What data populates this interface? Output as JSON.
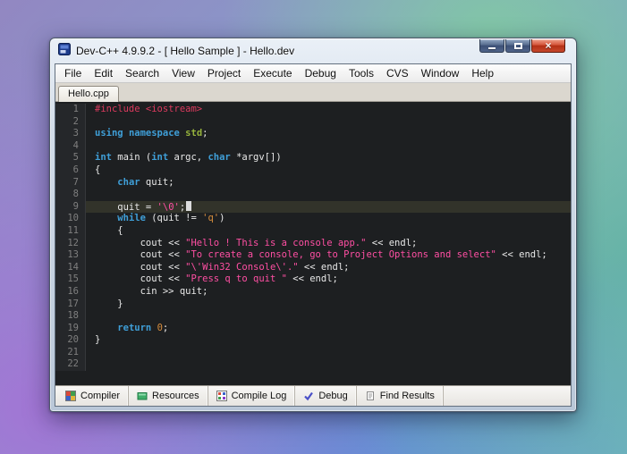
{
  "window": {
    "title": "Dev-C++ 4.9.9.2 -  [ Hello Sample ] - Hello.dev",
    "controls": {
      "close_glyph": "×"
    }
  },
  "menubar": {
    "items": [
      "File",
      "Edit",
      "Search",
      "View",
      "Project",
      "Execute",
      "Debug",
      "Tools",
      "CVS",
      "Window",
      "Help"
    ]
  },
  "editor_tab": {
    "label": "Hello.cpp"
  },
  "editor": {
    "language": "cpp",
    "current_line": 9,
    "lines": [
      {
        "segs": [
          [
            "pp",
            "#include <iostream>"
          ]
        ]
      },
      {
        "segs": []
      },
      {
        "segs": [
          [
            "kw",
            "using"
          ],
          [
            "pl",
            " "
          ],
          [
            "kw",
            "namespace"
          ],
          [
            "pl",
            " "
          ],
          [
            "ty",
            "std"
          ],
          [
            "pl",
            ";"
          ]
        ]
      },
      {
        "segs": []
      },
      {
        "segs": [
          [
            "kw",
            "int"
          ],
          [
            "pl",
            " main ("
          ],
          [
            "kw",
            "int"
          ],
          [
            "pl",
            " argc, "
          ],
          [
            "kw",
            "char"
          ],
          [
            "pl",
            " *argv[])"
          ]
        ]
      },
      {
        "segs": [
          [
            "pl",
            "{"
          ]
        ]
      },
      {
        "segs": [
          [
            "pl",
            "    "
          ],
          [
            "kw",
            "char"
          ],
          [
            "pl",
            " quit;"
          ]
        ]
      },
      {
        "segs": []
      },
      {
        "current": true,
        "caret": true,
        "segs": [
          [
            "pl",
            "    quit = "
          ],
          [
            "str",
            "'\\0'"
          ],
          [
            "pl",
            ";"
          ]
        ]
      },
      {
        "segs": [
          [
            "pl",
            "    "
          ],
          [
            "kw",
            "while"
          ],
          [
            "pl",
            " (quit != "
          ],
          [
            "chr",
            "'q'"
          ],
          [
            "pl",
            ")"
          ]
        ]
      },
      {
        "segs": [
          [
            "pl",
            "    {"
          ]
        ]
      },
      {
        "segs": [
          [
            "pl",
            "        cout << "
          ],
          [
            "str",
            "\"Hello ! This is a console app.\""
          ],
          [
            "pl",
            " << endl;"
          ]
        ]
      },
      {
        "segs": [
          [
            "pl",
            "        cout << "
          ],
          [
            "str",
            "\"To create a console, go to Project Options and select\""
          ],
          [
            "pl",
            " << endl;"
          ]
        ]
      },
      {
        "segs": [
          [
            "pl",
            "        cout << "
          ],
          [
            "str",
            "\"\\'Win32 Console\\'.\""
          ],
          [
            "pl",
            " << endl;"
          ]
        ]
      },
      {
        "segs": [
          [
            "pl",
            "        cout << "
          ],
          [
            "str",
            "\"Press q to quit \""
          ],
          [
            "pl",
            " << endl;"
          ]
        ]
      },
      {
        "segs": [
          [
            "pl",
            "        cin >> quit;"
          ]
        ]
      },
      {
        "segs": [
          [
            "pl",
            "    }"
          ]
        ]
      },
      {
        "segs": []
      },
      {
        "segs": [
          [
            "pl",
            "    "
          ],
          [
            "kw",
            "return"
          ],
          [
            "pl",
            " "
          ],
          [
            "num",
            "0"
          ],
          [
            "pl",
            ";"
          ]
        ]
      },
      {
        "segs": [
          [
            "pl",
            "}"
          ]
        ]
      },
      {
        "segs": []
      },
      {
        "segs": []
      }
    ]
  },
  "bottom_tabs": [
    {
      "label": "Compiler"
    },
    {
      "label": "Resources"
    },
    {
      "label": "Compile Log"
    },
    {
      "label": "Debug"
    },
    {
      "label": "Find Results"
    }
  ],
  "colors": {
    "editor_bg": "#1d1f21",
    "keyword": "#3f9fd8",
    "preprocessor": "#dc3a5e",
    "string": "#ff4fa3",
    "char_literal": "#d78d3d",
    "current_line_bg": "#32332a",
    "close_button": "#c6482c"
  }
}
